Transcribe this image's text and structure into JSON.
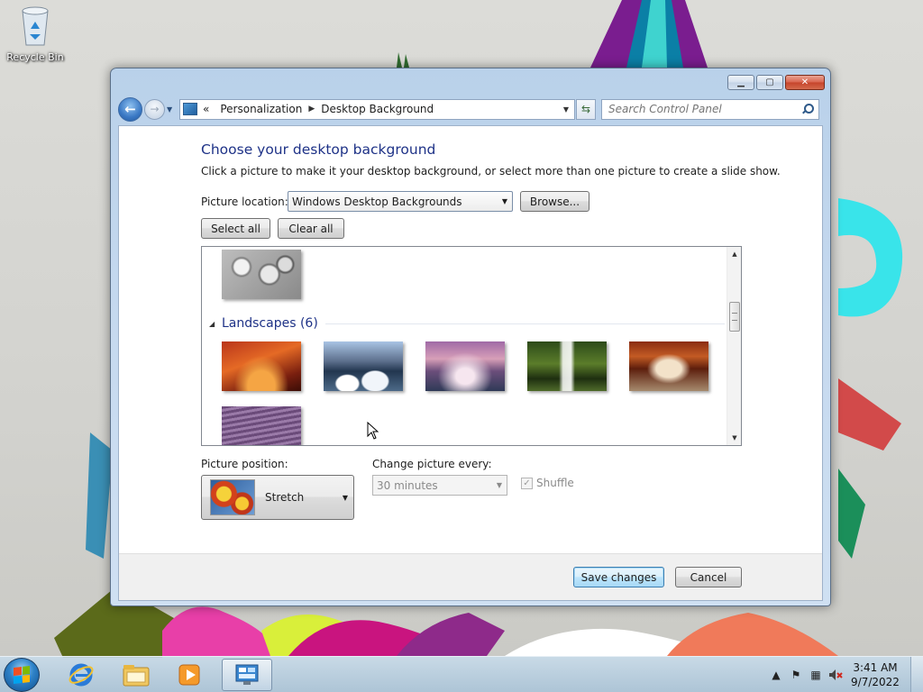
{
  "desktop": {
    "icons": [
      {
        "label": "Recycle Bin",
        "icon": "recycle-bin-icon"
      }
    ]
  },
  "window": {
    "caption_buttons": {
      "minimize": "minimize-icon",
      "maximize": "maximize-icon",
      "close": "close-icon"
    },
    "address": {
      "crumbs_prefix": "«",
      "crumbs": [
        "Personalization",
        "Desktop Background"
      ]
    },
    "search": {
      "placeholder": "Search Control Panel"
    },
    "heading": "Choose your desktop background",
    "subtext": "Click a picture to make it your desktop background, or select more than one picture to create a slide show.",
    "picture_location": {
      "label": "Picture location:",
      "value": "Windows Desktop Backgrounds"
    },
    "browse_label": "Browse...",
    "select_all_label": "Select all",
    "clear_all_label": "Clear all",
    "gallery": {
      "group": {
        "title": "Landscapes (6)"
      },
      "images": [
        "previous-group-image",
        "landscape-1",
        "landscape-2",
        "landscape-3",
        "landscape-4",
        "landscape-5",
        "landscape-6"
      ]
    },
    "picture_position": {
      "label": "Picture position:",
      "value": "Stretch"
    },
    "change_picture": {
      "label": "Change picture every:",
      "value": "30 minutes"
    },
    "shuffle": {
      "label": "Shuffle",
      "checked": true,
      "enabled": false
    },
    "save_label": "Save changes",
    "cancel_label": "Cancel"
  },
  "taskbar": {
    "pinned": [
      "start-orb",
      "internet-explorer-icon",
      "windows-explorer-icon",
      "media-player-icon",
      "control-panel-icon"
    ],
    "active": "control-panel-icon",
    "clock": {
      "time": "3:41 AM",
      "date": "9/7/2022"
    }
  },
  "colors": {
    "heading": "#1e3287",
    "accent": "#3c7fb1"
  }
}
